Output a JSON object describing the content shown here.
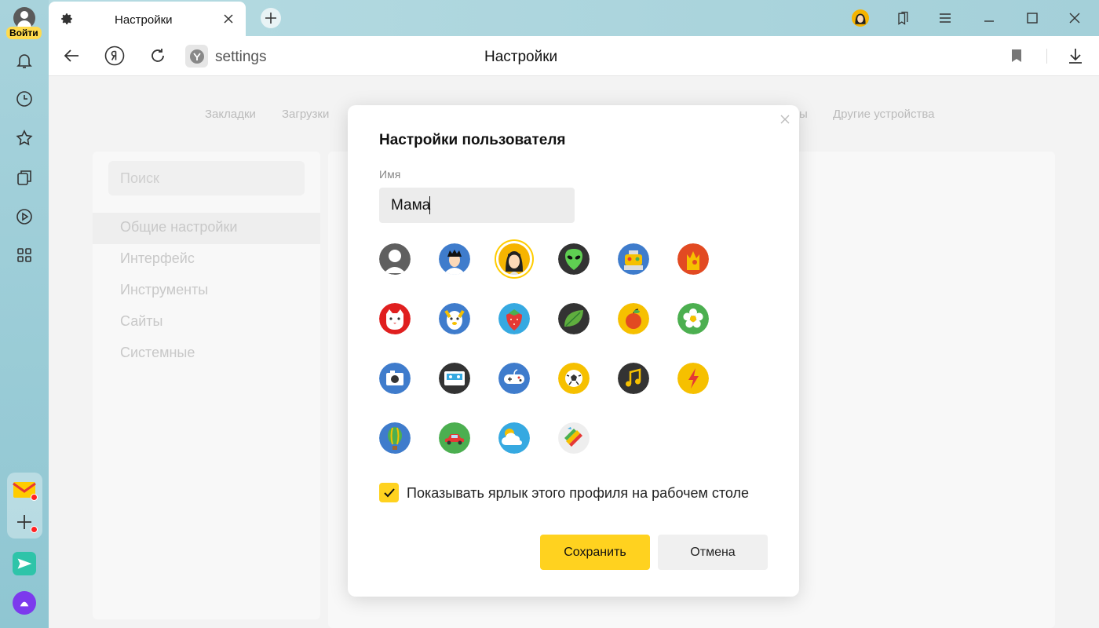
{
  "sidebar": {
    "login_label": "Войти",
    "items": [
      "bell-icon",
      "history-icon",
      "favorites-icon",
      "collections-icon",
      "video-icon",
      "apps-icon"
    ],
    "apps": [
      "mail-icon",
      "add-icon",
      "messenger-icon",
      "alice-icon"
    ]
  },
  "tabs": [
    {
      "title": "Настройки"
    }
  ],
  "address": {
    "url": "settings",
    "page_title": "Настройки"
  },
  "settings": {
    "topnav": [
      "Закладки",
      "Загрузки",
      "ы",
      "Другие устройства"
    ],
    "search_placeholder": "Поиск",
    "menu": [
      "Общие настройки",
      "Интерфейс",
      "Инструменты",
      "Сайты",
      "Системные"
    ]
  },
  "dialog": {
    "title": "Настройки пользователя",
    "name_label": "Имя",
    "name_value": "Мама",
    "avatars": [
      {
        "name": "default-user",
        "selected": false
      },
      {
        "name": "boy",
        "selected": false
      },
      {
        "name": "girl",
        "selected": true
      },
      {
        "name": "alien",
        "selected": false
      },
      {
        "name": "robot",
        "selected": false
      },
      {
        "name": "cat-fire",
        "selected": false
      },
      {
        "name": "cat",
        "selected": false
      },
      {
        "name": "dog",
        "selected": false
      },
      {
        "name": "strawberry",
        "selected": false
      },
      {
        "name": "leaf",
        "selected": false
      },
      {
        "name": "apple",
        "selected": false
      },
      {
        "name": "flower",
        "selected": false
      },
      {
        "name": "camera",
        "selected": false
      },
      {
        "name": "cassette",
        "selected": false
      },
      {
        "name": "gamepad",
        "selected": false
      },
      {
        "name": "soccer-ball",
        "selected": false
      },
      {
        "name": "music-note",
        "selected": false
      },
      {
        "name": "lightning",
        "selected": false
      },
      {
        "name": "balloon",
        "selected": false
      },
      {
        "name": "car",
        "selected": false
      },
      {
        "name": "cloud",
        "selected": false
      },
      {
        "name": "paint",
        "selected": false
      }
    ],
    "shortcut_checkbox": {
      "checked": true,
      "label": "Показывать ярлык этого профиля на рабочем столе"
    },
    "save_label": "Сохранить",
    "cancel_label": "Отмена"
  },
  "colors": {
    "accent": "#ffd21f",
    "sidebar": "#9fcfd9"
  }
}
